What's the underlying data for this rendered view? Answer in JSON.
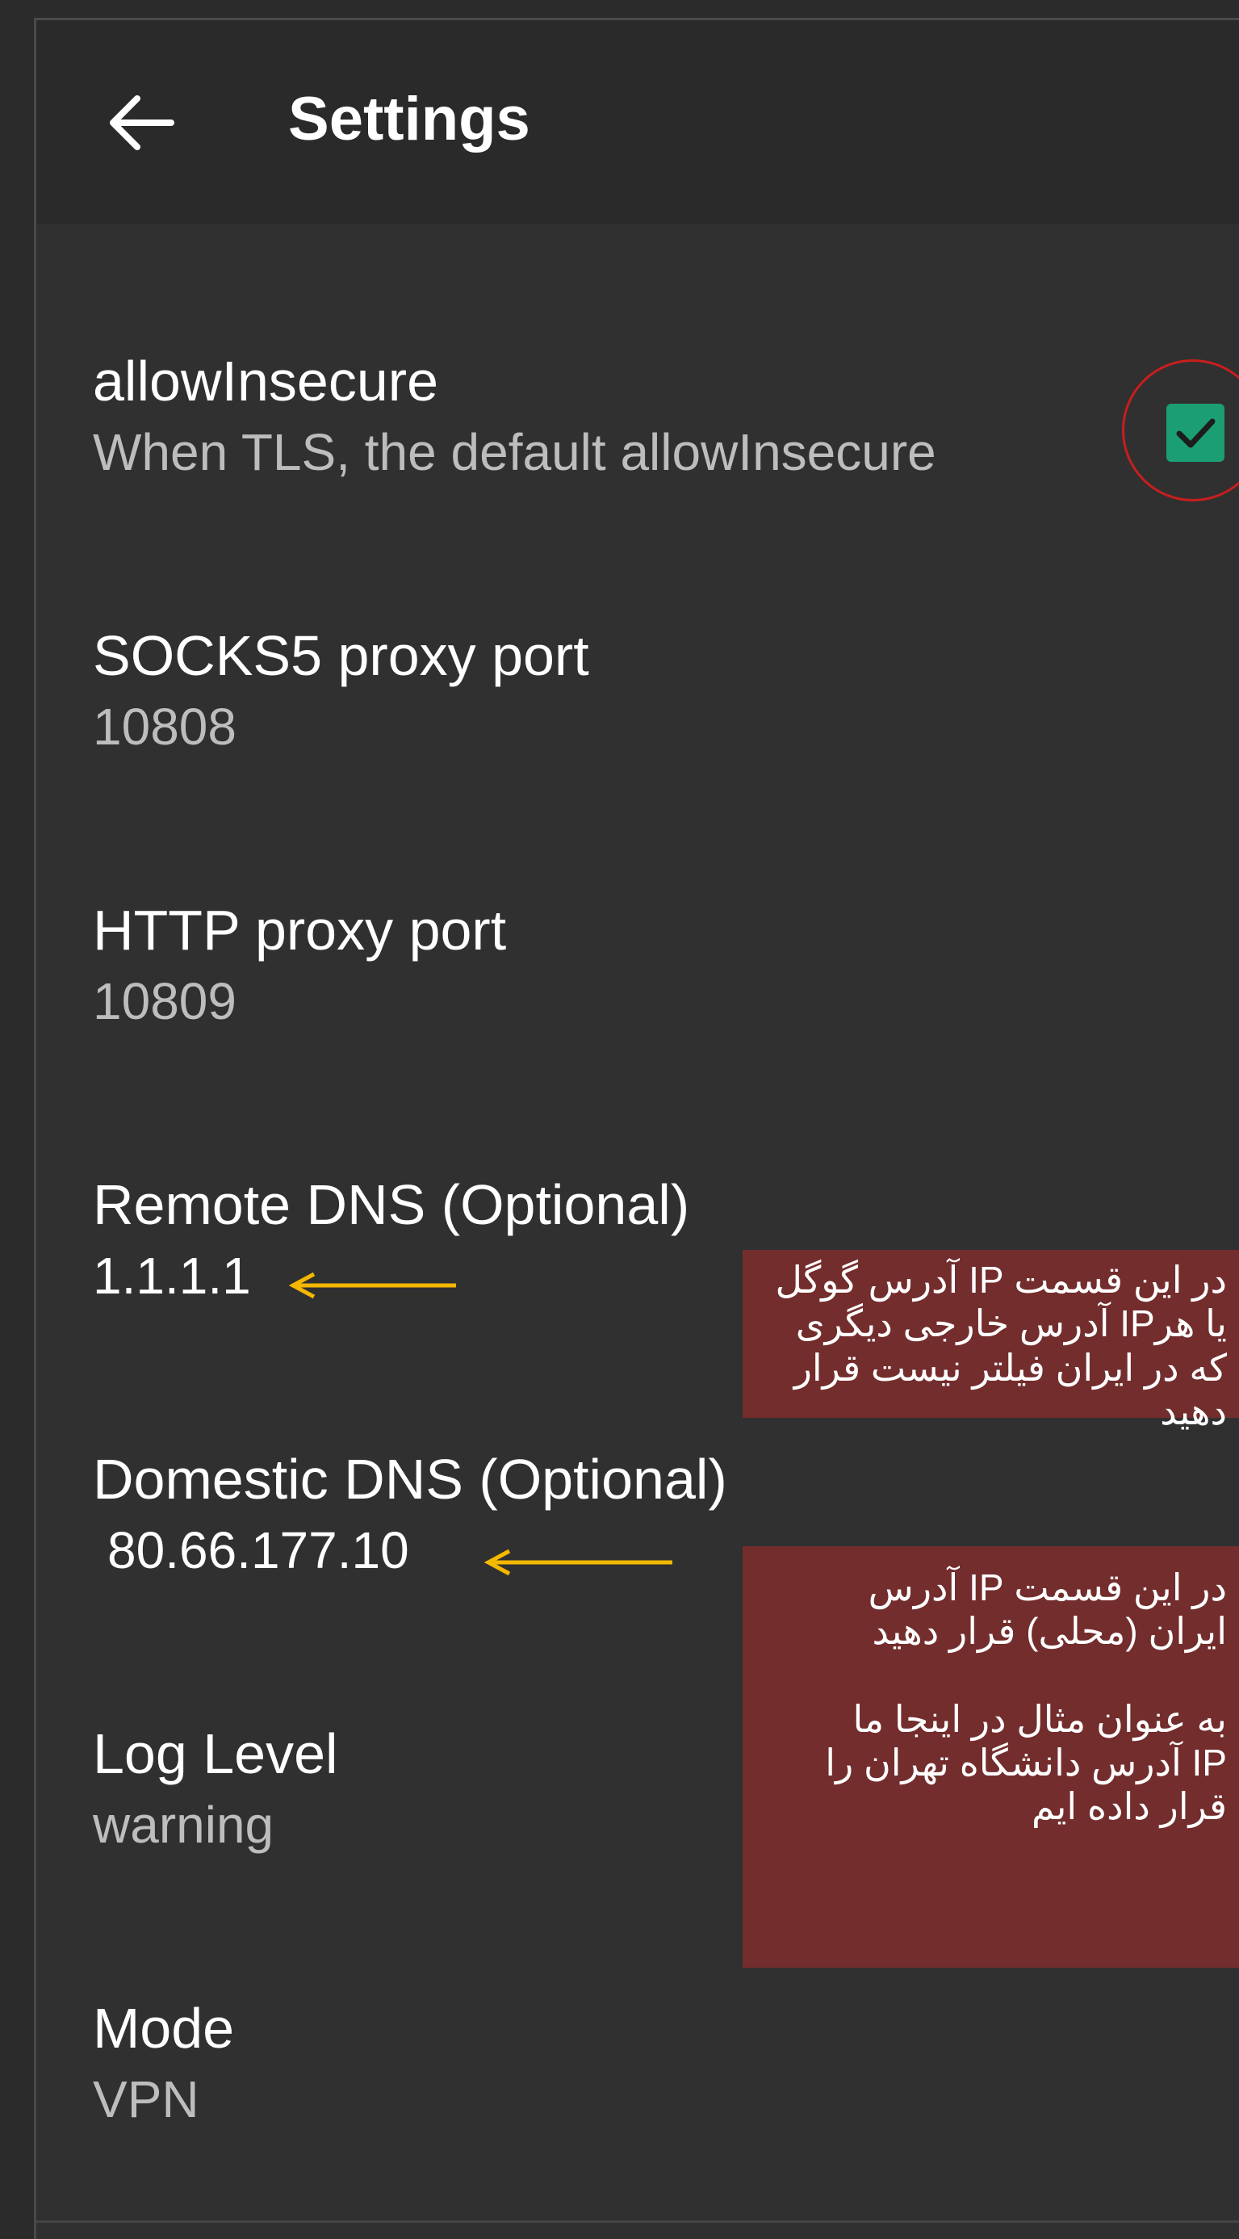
{
  "appbar": {
    "title": "Settings",
    "back_icon": "arrow-back-icon"
  },
  "preferences": [
    {
      "title": "allowInsecure",
      "summary": "When TLS, the default allowInsecure",
      "checked": true
    },
    {
      "title": "SOCKS5 proxy port",
      "summary": "10808"
    },
    {
      "title": "HTTP proxy port",
      "summary": "10809"
    },
    {
      "title": "Remote DNS (Optional)",
      "summary": "1.1.1.1"
    },
    {
      "title": "Domestic DNS (Optional)",
      "summary": "80.66.177.10"
    },
    {
      "title": "Log Level",
      "summary": "warning"
    },
    {
      "title": "Mode",
      "summary": "VPN"
    }
  ],
  "annotations": {
    "remote_dns_note": "در این قسمت IP آدرس گوگل\nیا هرIP آدرس خارجی دیگری\nکه در ایران فیلتر نیست قرار دهید",
    "domestic_dns_note": "در این قسمت IP آدرس\nایران (محلی) قرار دهید\n\nبه عنوان مثال در اینجا ما\nIP آدرس دانشگاه تهران را\nقرار داده ایم"
  },
  "colors": {
    "background": "#303030",
    "appbar": "#2a2a2a",
    "checkbox_accent": "#1b9e74",
    "highlight_circle": "#c81e1e",
    "arrow": "#f5b800",
    "note_background": "#732d2d"
  }
}
